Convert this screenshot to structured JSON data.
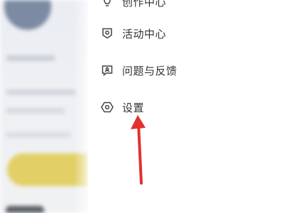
{
  "menu": {
    "items": [
      {
        "label": "创作中心",
        "icon": "bulb-icon"
      },
      {
        "label": "活动中心",
        "icon": "badge-icon"
      },
      {
        "label": "问题与反馈",
        "icon": "feedback-icon"
      },
      {
        "label": "设置",
        "icon": "gear-icon"
      }
    ]
  },
  "colors": {
    "annotation_arrow": "#e0322f",
    "menu_text": "#333333",
    "icon_stroke": "#444444",
    "background_banner": "#e2cf66"
  }
}
